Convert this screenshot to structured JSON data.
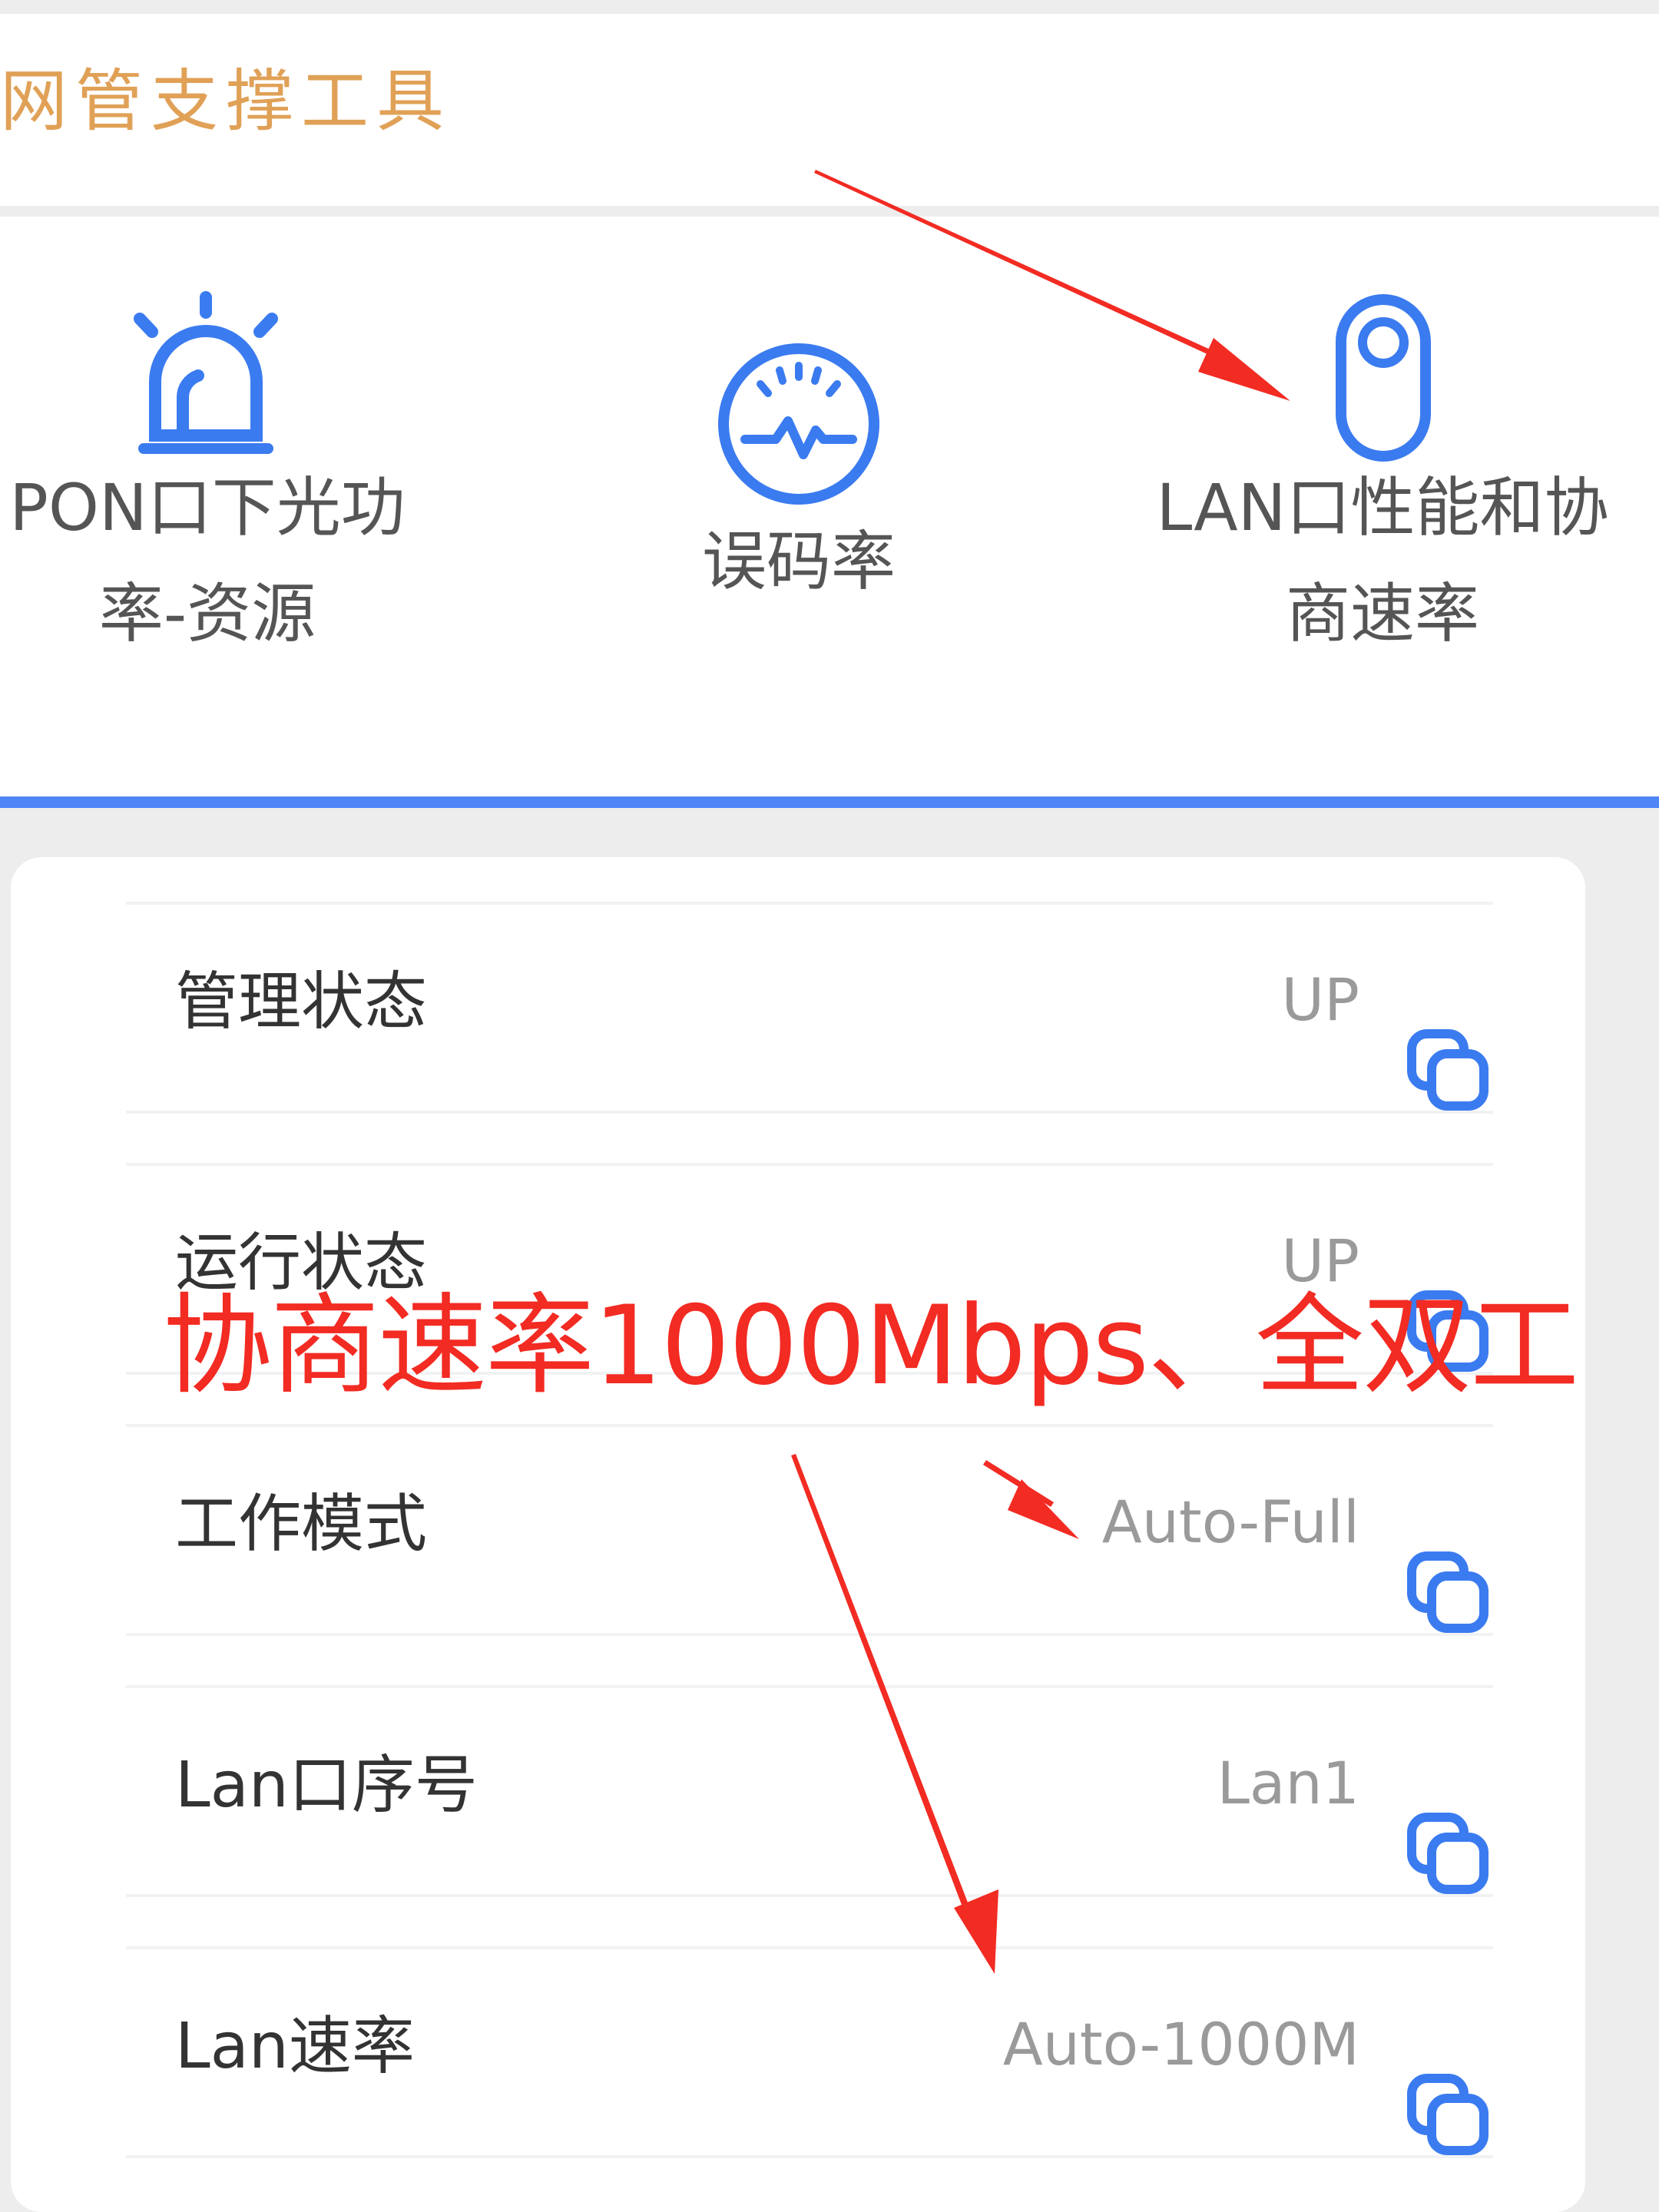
{
  "header": {
    "title": "网管支撑工具"
  },
  "tools": [
    {
      "label_line1": "PON口下光功",
      "label_line2": "率-资源",
      "icon": "siren-icon"
    },
    {
      "label_line1": "误码率",
      "label_line2": "",
      "icon": "gauge-icon"
    },
    {
      "label_line1": "LAN口性能和协",
      "label_line2": "商速率",
      "icon": "toggle-icon"
    }
  ],
  "rows": [
    {
      "label": "管理状态",
      "value": "UP"
    },
    {
      "label": "运行状态",
      "value": "UP"
    },
    {
      "label": "工作模式",
      "value": "Auto-Full"
    },
    {
      "label": "Lan口序号",
      "value": "Lan1"
    },
    {
      "label": "Lan速率",
      "value": "Auto-1000M"
    }
  ],
  "annotation": {
    "text": "协商速率1000Mbps、全双工"
  },
  "colors": {
    "accent_blue": "#4f86f7",
    "title_orange": "#e0a157",
    "annotation_red": "#f22b23"
  }
}
